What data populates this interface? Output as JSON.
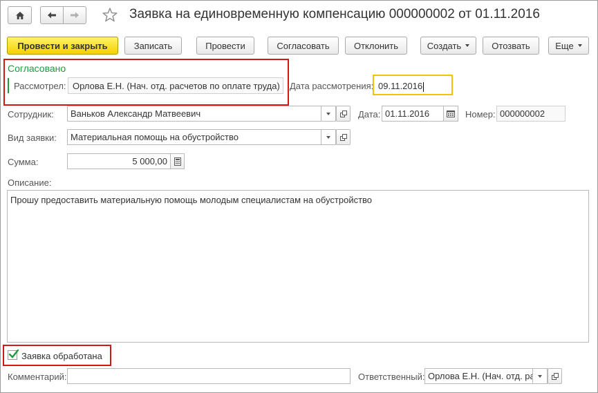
{
  "window": {
    "title": "Заявка на единовременную компенсацию 000000002 от 01.11.2016"
  },
  "toolbar": {
    "post_close": "Провести и закрыть",
    "save": "Записать",
    "post": "Провести",
    "approve": "Согласовать",
    "reject": "Отклонить",
    "create": "Создать",
    "recall": "Отозвать",
    "more": "Еще"
  },
  "approval": {
    "status": "Согласовано",
    "reviewer_label": "Рассмотрел:",
    "reviewer_value": "Орлова Е.Н. (Нач. отд. расчетов по оплате труда)",
    "review_date_label": "Дата рассмотрения:",
    "review_date_value": "09.11.2016"
  },
  "form": {
    "employee_label": "Сотрудник:",
    "employee_value": "Ваньков Александр Матвеевич",
    "date_label": "Дата:",
    "date_value": "01.11.2016",
    "number_label": "Номер:",
    "number_value": "000000002",
    "request_type_label": "Вид заявки:",
    "request_type_value": "Материальная помощь на обустройство",
    "amount_label": "Сумма:",
    "amount_value": "5 000,00",
    "description_label": "Описание:",
    "description_value": "Прошу предоставить материальную помощь молодым специалистам на обустройство",
    "processed_label": "Заявка обработана",
    "processed_checked": true,
    "comment_label": "Комментарий:",
    "comment_value": "",
    "responsible_label": "Ответственный:",
    "responsible_value": "Орлова Е.Н. (Нач. отд. ра"
  },
  "colors": {
    "primary_button": "#f5d100",
    "status_green": "#1f9a3c",
    "highlight_red": "#d01818",
    "date_focus": "#f2c200"
  },
  "icons": [
    "home-icon",
    "back-arrow-icon",
    "forward-arrow-icon",
    "star-icon",
    "calendar-icon",
    "calculator-icon",
    "open-icon",
    "checkmark-icon"
  ]
}
